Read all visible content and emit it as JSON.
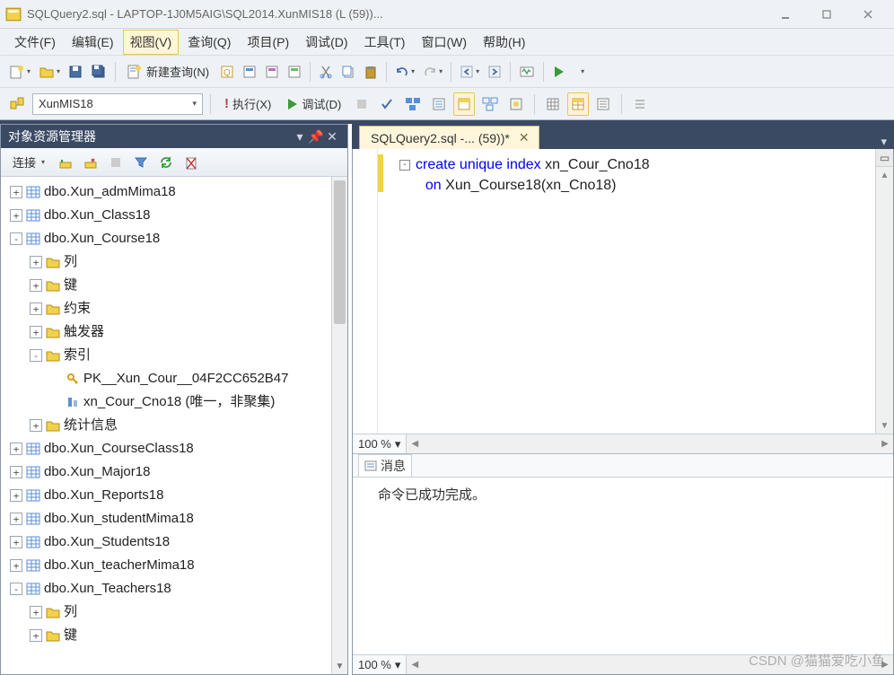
{
  "window": {
    "title": "SQLQuery2.sql - LAPTOP-1J0M5AIG\\SQL2014.XunMIS18 (L                                  (59))..."
  },
  "menubar": {
    "items": [
      {
        "label": "文件(F)"
      },
      {
        "label": "编辑(E)"
      },
      {
        "label": "视图(V)",
        "highlight": true
      },
      {
        "label": "查询(Q)"
      },
      {
        "label": "项目(P)"
      },
      {
        "label": "调试(D)"
      },
      {
        "label": "工具(T)"
      },
      {
        "label": "窗口(W)"
      },
      {
        "label": "帮助(H)"
      }
    ]
  },
  "toolbar1": {
    "new_query": "新建查询(N)"
  },
  "toolbar2": {
    "database": "XunMIS18",
    "execute": "执行(X)",
    "debug": "调试(D)"
  },
  "object_explorer": {
    "title": "对象资源管理器",
    "connect": "连接",
    "tree": [
      {
        "level": 0,
        "exp": "+",
        "icon": "table",
        "label": "dbo.Xun_admMima18"
      },
      {
        "level": 0,
        "exp": "+",
        "icon": "table",
        "label": "dbo.Xun_Class18"
      },
      {
        "level": 0,
        "exp": "-",
        "icon": "table",
        "label": "dbo.Xun_Course18"
      },
      {
        "level": 1,
        "exp": "+",
        "icon": "folder",
        "label": "列"
      },
      {
        "level": 1,
        "exp": "+",
        "icon": "folder",
        "label": "键"
      },
      {
        "level": 1,
        "exp": "+",
        "icon": "folder",
        "label": "约束"
      },
      {
        "level": 1,
        "exp": "+",
        "icon": "folder",
        "label": "触发器"
      },
      {
        "level": 1,
        "exp": "-",
        "icon": "folder",
        "label": "索引"
      },
      {
        "level": 2,
        "exp": "",
        "icon": "key",
        "label": "PK__Xun_Cour__04F2CC652B47"
      },
      {
        "level": 2,
        "exp": "",
        "icon": "index",
        "label": "xn_Cour_Cno18 (唯一，非聚集)"
      },
      {
        "level": 1,
        "exp": "+",
        "icon": "folder",
        "label": "统计信息"
      },
      {
        "level": 0,
        "exp": "+",
        "icon": "table",
        "label": "dbo.Xun_CourseClass18"
      },
      {
        "level": 0,
        "exp": "+",
        "icon": "table",
        "label": "dbo.Xun_Major18"
      },
      {
        "level": 0,
        "exp": "+",
        "icon": "table",
        "label": "dbo.Xun_Reports18"
      },
      {
        "level": 0,
        "exp": "+",
        "icon": "table",
        "label": "dbo.Xun_studentMima18"
      },
      {
        "level": 0,
        "exp": "+",
        "icon": "table",
        "label": "dbo.Xun_Students18"
      },
      {
        "level": 0,
        "exp": "+",
        "icon": "table",
        "label": "dbo.Xun_teacherMima18"
      },
      {
        "level": 0,
        "exp": "-",
        "icon": "table",
        "label": "dbo.Xun_Teachers18"
      },
      {
        "level": 1,
        "exp": "+",
        "icon": "folder",
        "label": "列"
      },
      {
        "level": 1,
        "exp": "+",
        "icon": "folder",
        "label": "键"
      }
    ]
  },
  "editor": {
    "tab_title": "SQLQuery2.sql -...                       (59))*",
    "code_line1_pre": "create unique index",
    "code_line1_post": " xn_Cour_Cno18",
    "code_line2_pre": "on",
    "code_line2_post": " Xun_Course18(xn_Cno18)",
    "zoom": "100 %"
  },
  "messages": {
    "tab": "消息",
    "text": "命令已成功完成。",
    "zoom": "100 %"
  },
  "watermark": "CSDN @猫猫爱吃小鱼"
}
